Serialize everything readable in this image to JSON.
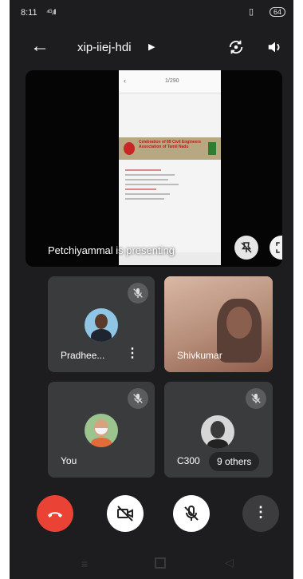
{
  "status": {
    "time": "8:11",
    "signal": "⁴ᴳ.ıll",
    "battery": "64"
  },
  "header": {
    "meeting_code": "xip-iiej-hdi"
  },
  "presenter": {
    "name": "Petchiyammal is presenting",
    "slide_page": "1/290",
    "banner_text": "Celebration of 89 Civil Engineers Association of Tamil Nadu"
  },
  "participants": [
    {
      "name": "Pradhee..."
    },
    {
      "name": "Shivkumar"
    },
    {
      "name": "You"
    },
    {
      "name": "C300"
    }
  ],
  "others_badge": "9 others",
  "colors": {
    "end_call": "#ea4335",
    "tile": "#3a3b3d",
    "background": "#1d1d1f"
  }
}
